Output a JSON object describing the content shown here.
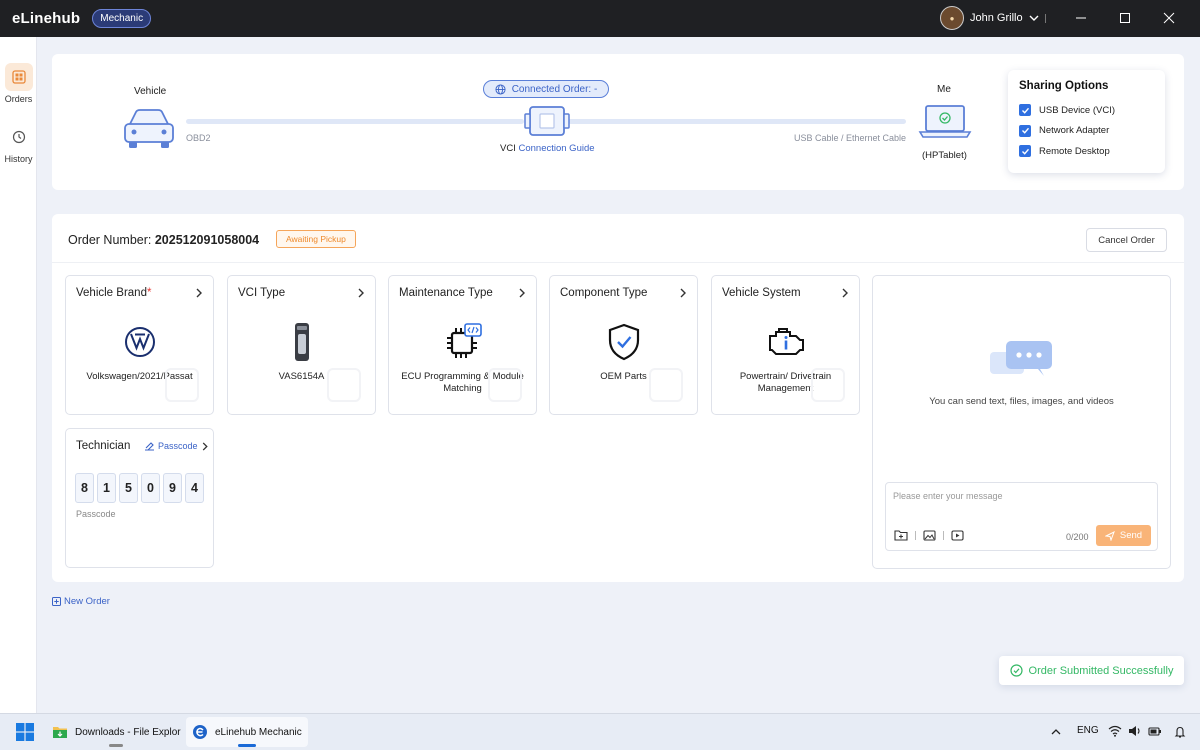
{
  "app": {
    "name": "eLinehub",
    "role": "Mechanic"
  },
  "user": {
    "name": "John Grillo"
  },
  "nav": [
    {
      "label": "Orders",
      "icon": "orders-icon",
      "active": true
    },
    {
      "label": "History",
      "icon": "history-icon",
      "active": false
    }
  ],
  "connection": {
    "vehicle_label": "Vehicle",
    "obd": "OBD2",
    "connected_order": "Connected Order: -",
    "vci_prefix": "VCI",
    "connection_guide": "Connection Guide",
    "cable": "USB Cable / Ethernet Cable",
    "me_label": "Me",
    "device": "(HPTablet)"
  },
  "sharing": {
    "title": "Sharing Options",
    "options": [
      {
        "label": "USB Device (VCI)",
        "checked": true
      },
      {
        "label": "Network Adapter",
        "checked": true
      },
      {
        "label": "Remote Desktop",
        "checked": true
      }
    ]
  },
  "order": {
    "number_label": "Order Number:",
    "number": "202512091058004",
    "status": "Awaiting Pickup",
    "cancel": "Cancel Order",
    "tiles": [
      {
        "title": "Vehicle Brand",
        "value": "Volkswagen/2021/Passat",
        "required": true,
        "icon": "volkswagen-logo-icon"
      },
      {
        "title": "VCI Type",
        "value": "VAS6154A",
        "icon": "vci-device-icon"
      },
      {
        "title": "Maintenance Type",
        "value": "ECU Programming & Module Matching",
        "icon": "ecu-chip-icon"
      },
      {
        "title": "Component Type",
        "value": "OEM Parts",
        "icon": "shield-check-icon"
      },
      {
        "title": "Vehicle System",
        "value": "Powertrain/ Drivetrain Management",
        "icon": "engine-icon"
      }
    ],
    "technician": {
      "title": "Technician",
      "passcode_link": "Passcode",
      "digits": [
        "8",
        "1",
        "5",
        "0",
        "9",
        "4"
      ],
      "caption": "Passcode"
    }
  },
  "chat": {
    "hint": "You can send text, files, images, and videos",
    "placeholder": "Please enter your message",
    "counter": "0/200",
    "send": "Send"
  },
  "new_order": "New Order",
  "toast": "Order Submitted Successfully",
  "taskbar": {
    "apps": [
      {
        "label": "Downloads - File Explor",
        "active": false
      },
      {
        "label": "eLinehub Mechanic",
        "active": true
      }
    ],
    "lang": "ENG"
  },
  "colors": {
    "accent": "#3b63c7",
    "brand_orange": "#f9b478",
    "success": "#34b865",
    "titlebar": "#1f2023"
  }
}
